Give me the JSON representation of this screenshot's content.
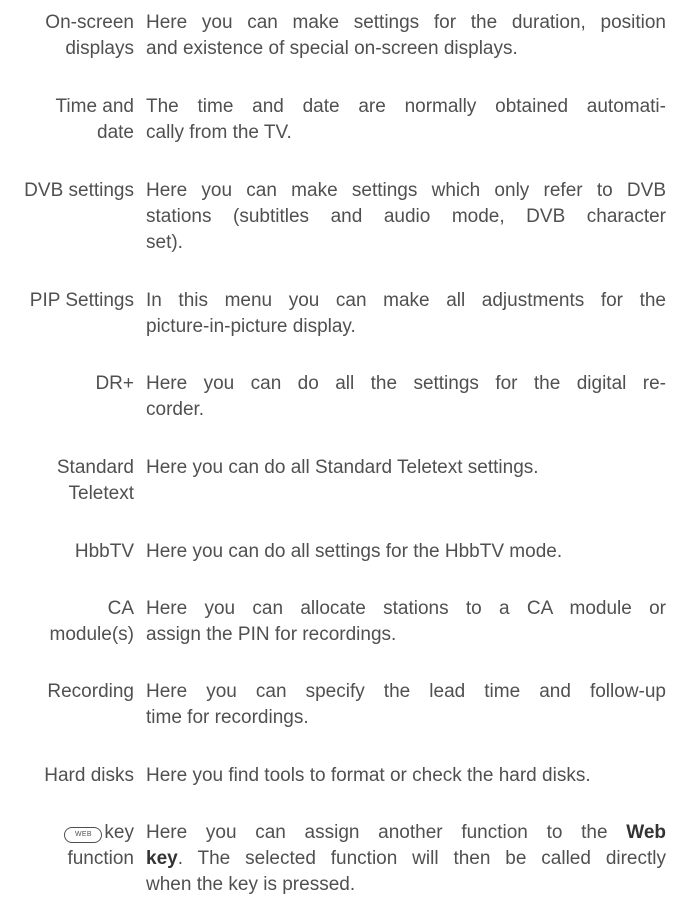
{
  "entries": [
    {
      "term": [
        "On-screen",
        "displays"
      ],
      "desc": [
        "Here you can make settings for the duration, position",
        "and existence of special on-screen displays."
      ]
    },
    {
      "term": [
        "Time and",
        "date"
      ],
      "desc": [
        "The time and date are normally obtained automati-",
        "cally from the TV."
      ]
    },
    {
      "term": [
        "DVB settings"
      ],
      "desc": [
        "Here you can make settings which only refer to DVB",
        "stations (subtitles and audio mode, DVB character",
        "set)."
      ]
    },
    {
      "term": [
        "PIP Settings"
      ],
      "desc": [
        "In this menu you can make all adjustments for the",
        "picture-in-picture display."
      ]
    },
    {
      "term": [
        "DR+"
      ],
      "desc": [
        "Here you can do all the settings for the digital re-",
        "corder."
      ]
    },
    {
      "term": [
        "Standard",
        "Teletext"
      ],
      "desc": [
        "Here you can do all Standard Teletext settings."
      ]
    },
    {
      "term": [
        "HbbTV"
      ],
      "desc": [
        "Here you can do all settings for the HbbTV mode."
      ]
    },
    {
      "term": [
        "CA",
        "module(s)"
      ],
      "desc": [
        "Here you can allocate stations to a CA module or",
        "assign the PIN for recordings."
      ]
    },
    {
      "term": [
        "Recording"
      ],
      "desc": [
        "Here you can specify the lead time and follow-up",
        "time for recordings."
      ]
    },
    {
      "term": [
        "Hard disks"
      ],
      "desc": [
        "Here you find tools to format or check the hard disks."
      ]
    }
  ],
  "web_entry": {
    "key_icon_label": "WEB",
    "term_key": "key",
    "term_line2": "function",
    "desc_line1_pre": "Here you can assign another function to the",
    "desc_line1_bold": "Web",
    "desc_line2_bold": "key",
    "desc_line2_post": ". The selected function will then be called directly",
    "desc_line3": "when the key is pressed."
  }
}
